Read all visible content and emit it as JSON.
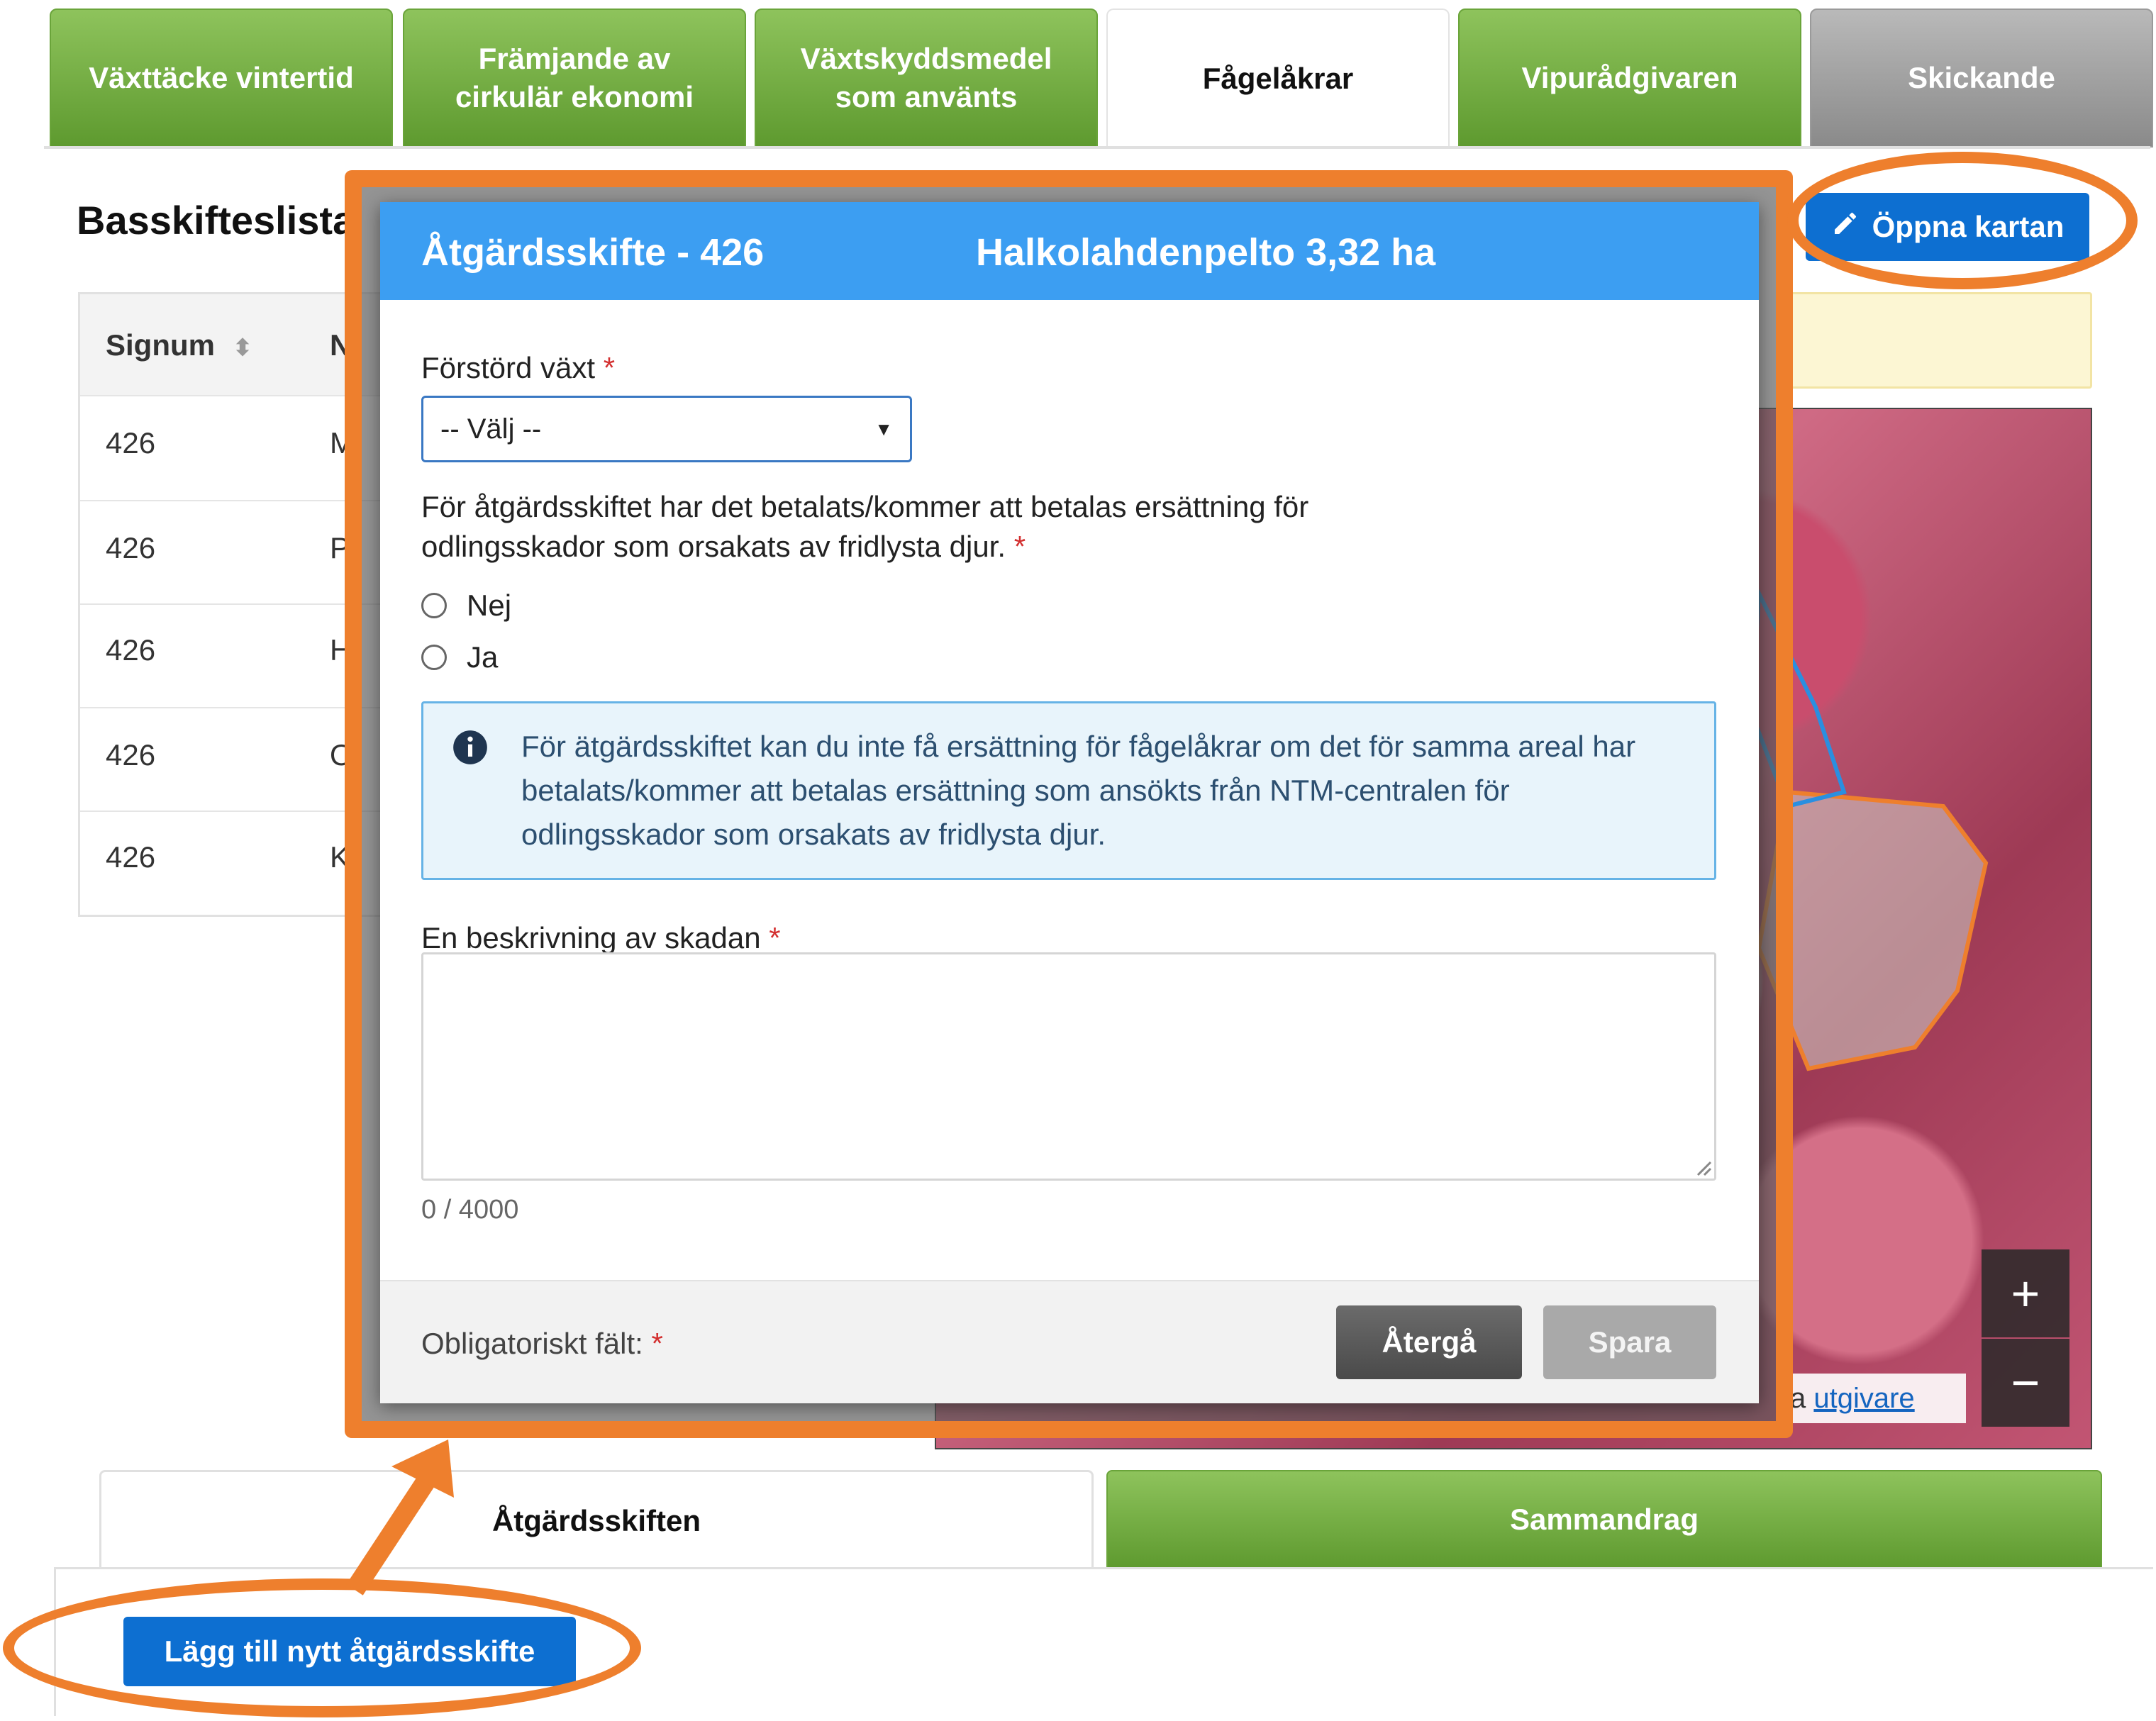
{
  "top_tabs": [
    {
      "label": "Växttäcke vintertid",
      "state": "inactive"
    },
    {
      "label": "Främjande av\ncirkulär ekonomi",
      "state": "inactive"
    },
    {
      "label": "Växtskyddsmedel\nsom använts",
      "state": "inactive"
    },
    {
      "label": "Fågelåkrar",
      "state": "active"
    },
    {
      "label": "Vipurådgivaren",
      "state": "inactive"
    },
    {
      "label": "Skickande",
      "state": "disabled"
    }
  ],
  "base_list": {
    "title": "Basskifteslista",
    "columns": [
      "Signum",
      "N"
    ],
    "rows": [
      {
        "signum": "426",
        "name_start": "M"
      },
      {
        "signum": "426",
        "name_start": "P"
      },
      {
        "signum": "426",
        "name_start": "H"
      },
      {
        "signum": "426",
        "name_start": "O"
      },
      {
        "signum": "426",
        "name_start": "K"
      }
    ]
  },
  "open_map_button": {
    "label": "Öppna kartan",
    "icon": "edit-icon"
  },
  "map": {
    "attribution_prefix": "a",
    "attribution_link": "utgivare",
    "zoom_in": "+",
    "zoom_out": "−"
  },
  "bottom_tabs": [
    {
      "label": "Åtgärdsskiften",
      "state": "active"
    },
    {
      "label": "Sammandrag",
      "state": "inactive"
    }
  ],
  "add_button": {
    "label": "Lägg till nytt åtgärdsskifte"
  },
  "modal": {
    "title_left": "Åtgärdsskifte - 426",
    "title_right": "Halkolahdenpelto 3,32 ha",
    "destroyed_crop": {
      "label": "Förstörd växt",
      "required_mark": "*",
      "selected": "-- Välj --"
    },
    "compensation_question": {
      "label_line1": "För åtgärdsskiftet har det betalats/kommer att betalas ersättning för",
      "label_line2": "odlingsskador som orsakats av fridlysta djur.",
      "required_mark": "*",
      "options": [
        "Nej",
        "Ja"
      ]
    },
    "info": {
      "icon": "info-icon",
      "line1": "För ätgärdsskiftet kan du inte få ersättning för fågelåkrar om det för samma areal har",
      "line2": "betalats/kommer att betalas ersättning som ansökts från NTM-centralen för",
      "line3": "odlingsskador som orsakats av fridlysta djur."
    },
    "description": {
      "label": "En beskrivning av skadan",
      "required_mark": "*",
      "value": "",
      "counter": "0 / 4000"
    },
    "footer": {
      "required_note": "Obligatoriskt fält:",
      "required_mark": "*",
      "back_label": "Återgå",
      "save_label": "Spara"
    }
  },
  "colors": {
    "tab_green": "#6aa43a",
    "primary_blue": "#0d6fd1",
    "modal_header": "#3c9ef2",
    "annotation_orange": "#ee7f2d",
    "required_red": "#d32f2f"
  }
}
